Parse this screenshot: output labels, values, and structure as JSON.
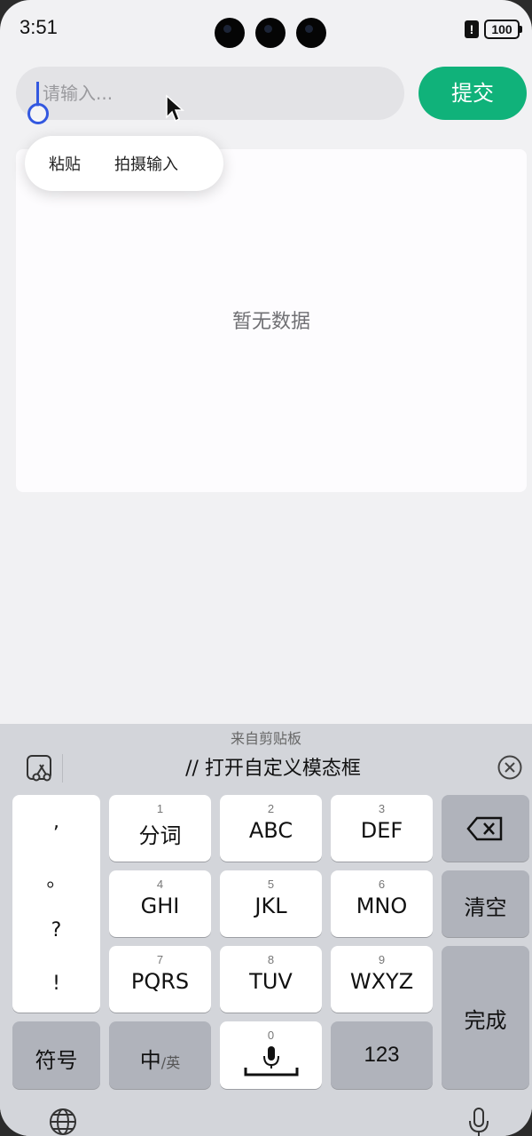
{
  "status_bar": {
    "time": "3:51",
    "alert": "!",
    "battery": "100"
  },
  "input": {
    "placeholder": "请输入...",
    "value": ""
  },
  "submit_button": {
    "label": "提交"
  },
  "context_menu": {
    "paste": "粘贴",
    "camera_input": "拍摄输入"
  },
  "content": {
    "empty_text": "暂无数据"
  },
  "keyboard": {
    "clipboard_title": "来自剪贴板",
    "clipboard_text": "// 打开自定义模态框",
    "punctuation": [
      ",",
      "。",
      "?",
      "!"
    ],
    "keys": [
      {
        "num": "1",
        "label": "分词"
      },
      {
        "num": "2",
        "label": "ABC"
      },
      {
        "num": "3",
        "label": "DEF"
      },
      {
        "num": "4",
        "label": "GHI"
      },
      {
        "num": "5",
        "label": "JKL"
      },
      {
        "num": "6",
        "label": "MNO"
      },
      {
        "num": "7",
        "label": "PQRS"
      },
      {
        "num": "8",
        "label": "TUV"
      },
      {
        "num": "9",
        "label": "WXYZ"
      }
    ],
    "clear_label": "清空",
    "done_label": "完成",
    "symbols_label": "符号",
    "lang_main": "中",
    "lang_alt": "/英",
    "space_num": "0",
    "numbers_label": "123"
  },
  "colors": {
    "accent": "#10b27a",
    "caret": "#3358e0",
    "keyboard_bg": "#d3d5da"
  }
}
